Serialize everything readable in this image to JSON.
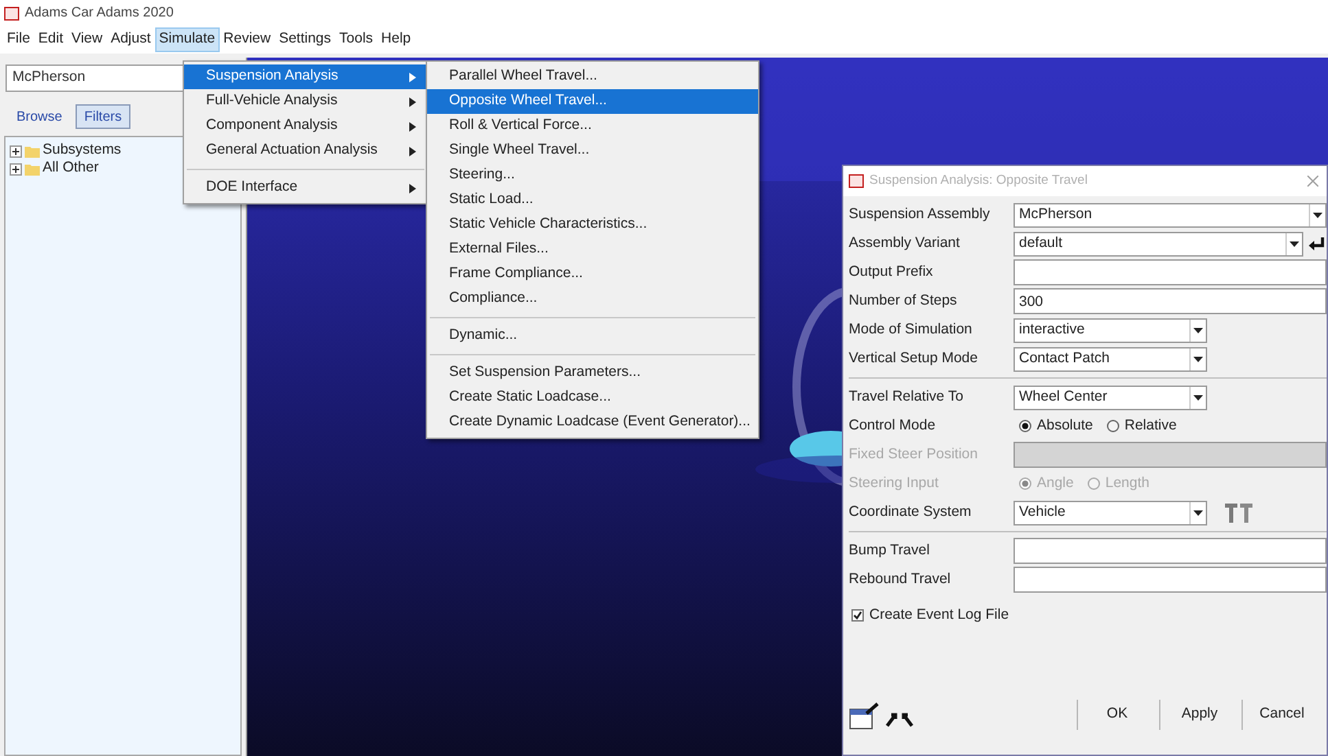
{
  "window": {
    "title": "Adams Car Adams 2020"
  },
  "menubar": [
    {
      "label": "File",
      "selected": false
    },
    {
      "label": "Edit",
      "selected": false
    },
    {
      "label": "View",
      "selected": false
    },
    {
      "label": "Adjust",
      "selected": false
    },
    {
      "label": "Simulate",
      "selected": true
    },
    {
      "label": "Review",
      "selected": false
    },
    {
      "label": "Settings",
      "selected": false
    },
    {
      "label": "Tools",
      "selected": false
    },
    {
      "label": "Help",
      "selected": false
    }
  ],
  "left_panel": {
    "model_field": "McPherson",
    "tabs": [
      {
        "label": "Browse",
        "selected": false
      },
      {
        "label": "Filters",
        "selected": true
      }
    ],
    "tree": [
      {
        "label": "Subsystems",
        "expanded": false
      },
      {
        "label": "All Other",
        "expanded": false
      }
    ]
  },
  "simulate_menu": [
    {
      "kind": "item",
      "label": "Suspension Analysis",
      "selected": true
    },
    {
      "kind": "item",
      "label": "Full-Vehicle Analysis",
      "selected": false
    },
    {
      "kind": "item",
      "label": "Component Analysis",
      "selected": false
    },
    {
      "kind": "item",
      "label": "General Actuation Analysis",
      "selected": false
    },
    {
      "kind": "separator"
    },
    {
      "kind": "item",
      "label": "DOE Interface",
      "selected": false
    }
  ],
  "suspension_submenu": [
    {
      "kind": "item",
      "label": "Parallel Wheel Travel...",
      "selected": false
    },
    {
      "kind": "item",
      "label": "Opposite Wheel Travel...",
      "selected": true
    },
    {
      "kind": "item",
      "label": "Roll & Vertical Force...",
      "selected": false
    },
    {
      "kind": "item",
      "label": "Single Wheel Travel...",
      "selected": false
    },
    {
      "kind": "item",
      "label": "Steering...",
      "selected": false
    },
    {
      "kind": "item",
      "label": "Static Load...",
      "selected": false
    },
    {
      "kind": "item",
      "label": "Static Vehicle Characteristics...",
      "selected": false
    },
    {
      "kind": "item",
      "label": "External Files...",
      "selected": false
    },
    {
      "kind": "item",
      "label": "Frame Compliance...",
      "selected": false
    },
    {
      "kind": "item",
      "label": "Compliance...",
      "selected": false
    },
    {
      "kind": "separator"
    },
    {
      "kind": "item",
      "label": "Dynamic...",
      "selected": false
    },
    {
      "kind": "separator"
    },
    {
      "kind": "item",
      "label": "Set Suspension Parameters...",
      "selected": false
    },
    {
      "kind": "item",
      "label": "Create Static Loadcase...",
      "selected": false
    },
    {
      "kind": "item",
      "label": "Create Dynamic Loadcase (Event Generator)...",
      "selected": false
    }
  ],
  "dialog": {
    "title": "Suspension Analysis: Opposite Travel",
    "rows": [
      {
        "kind": "combo",
        "label": "Suspension Assembly",
        "value": "McPherson",
        "wide": true
      },
      {
        "kind": "combo",
        "label": "Assembly Variant",
        "value": "default",
        "wide": true,
        "enter_button": true
      },
      {
        "kind": "input",
        "label": "Output Prefix",
        "disabled": false
      },
      {
        "kind": "input",
        "label": "Number of Steps",
        "value": "300",
        "disabled": false
      },
      {
        "kind": "combo",
        "label": "Mode of Simulation",
        "value": "interactive",
        "wide": false
      },
      {
        "kind": "combo",
        "label": "Vertical Setup Mode",
        "value": "Contact Patch",
        "wide": false
      },
      {
        "kind": "separator"
      },
      {
        "kind": "combo",
        "label": "Travel Relative To",
        "value": "Wheel Center",
        "wide": false
      },
      {
        "kind": "radios",
        "label": "Control Mode",
        "disabled": false,
        "options": [
          {
            "label": "Absolute",
            "selected": true
          },
          {
            "label": "Relative",
            "selected": false
          }
        ]
      },
      {
        "kind": "input",
        "label": "Fixed Steer Position",
        "disabled": true
      },
      {
        "kind": "radios",
        "label": "Steering Input",
        "disabled": true,
        "options": [
          {
            "label": "Angle",
            "selected": true
          },
          {
            "label": "Length",
            "selected": false
          }
        ]
      },
      {
        "kind": "combo",
        "label": "Coordinate System",
        "value": "Vehicle",
        "wide": false,
        "triad_button": true
      },
      {
        "kind": "separator"
      },
      {
        "kind": "input",
        "label": "Bump Travel",
        "disabled": false
      },
      {
        "kind": "input",
        "label": "Rebound Travel",
        "disabled": false
      }
    ],
    "log_checkbox": {
      "label": "Create Event Log File",
      "checked": true
    },
    "buttons": [
      "OK",
      "Apply",
      "Cancel"
    ]
  }
}
